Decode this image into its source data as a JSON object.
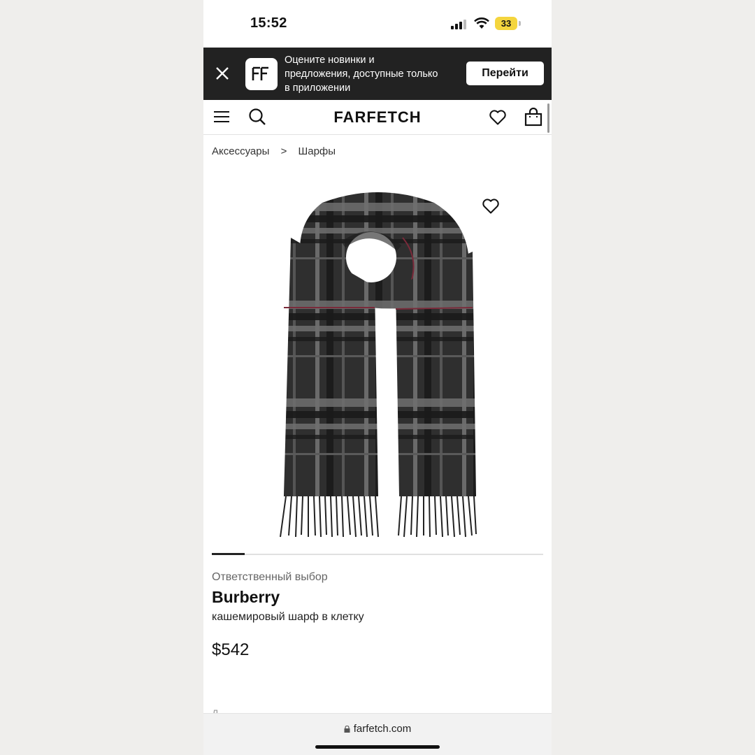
{
  "status_bar": {
    "time": "15:52",
    "battery": "33"
  },
  "app_banner": {
    "text_lines": [
      "Оцените новинки и",
      "предложения, доступные только",
      "в приложении"
    ],
    "button_label": "Перейти"
  },
  "header": {
    "logo": "FARFETCH"
  },
  "breadcrumb": {
    "items": [
      "Аксессуары",
      ">",
      "Шарфы"
    ]
  },
  "product": {
    "label": "Ответственный выбор",
    "brand": "Burberry",
    "description": "кашемировый шарф в клетку",
    "price": "$542"
  },
  "carousel": {
    "active_index": 1,
    "progress": 0.1
  },
  "browser": {
    "url": "farfetch.com"
  },
  "colors": {
    "banner_bg": "#222222",
    "battery": "#f4d53e",
    "scarf_dark": "#2e2e2e",
    "scarf_grey": "#6e6e6e",
    "scarf_red": "#7a2a3a"
  },
  "icons": [
    "close-icon",
    "farfetch-app-icon",
    "menu-icon",
    "search-icon",
    "heart-icon",
    "bag-icon",
    "lock-icon"
  ]
}
